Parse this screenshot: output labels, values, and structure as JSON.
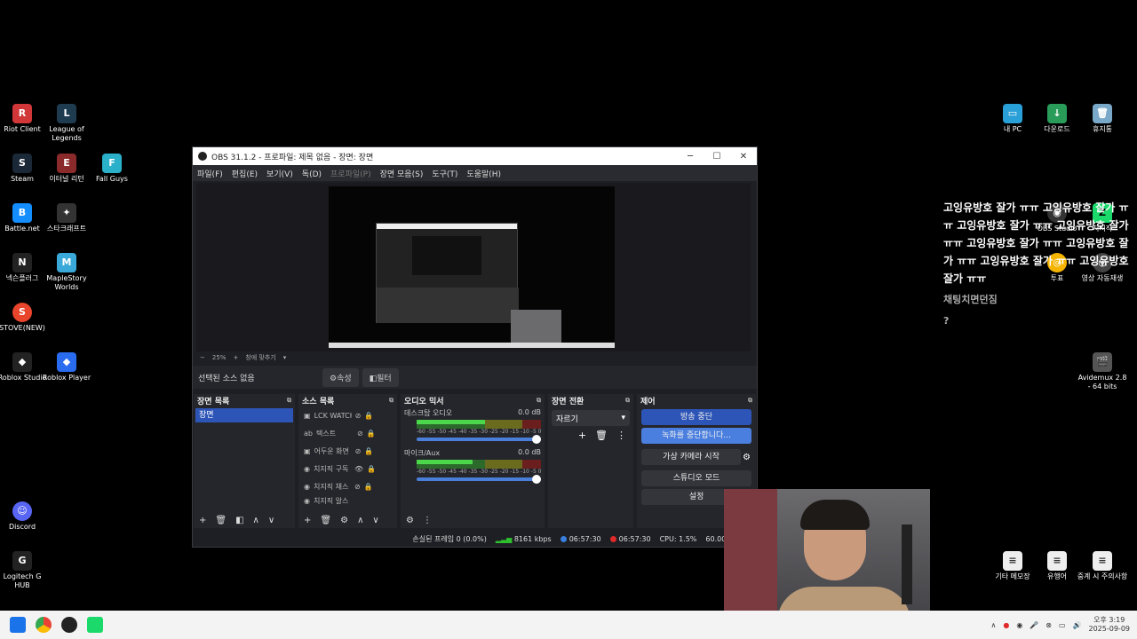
{
  "desktop_icons": [
    {
      "label": "Riot Client",
      "icon": "riot-icon",
      "color": "#d13639"
    },
    {
      "label": "League of Legends",
      "icon": "league-icon",
      "color": "#1f3b50"
    },
    {
      "label": "Steam",
      "icon": "steam-icon",
      "color": "#1b2838"
    },
    {
      "label": "이터널 리턴",
      "icon": "eternal-return-icon",
      "color": "#8b2a2a"
    },
    {
      "label": "Fall Guys",
      "icon": "fallguys-icon",
      "color": "#2ab0c8"
    },
    {
      "label": "Battle.net",
      "icon": "battlenet-icon",
      "color": "#148eff"
    },
    {
      "label": "스타크래프트",
      "icon": "starcraft-icon",
      "color": "#333"
    },
    {
      "label": "넥슨플러그",
      "icon": "nexon-icon",
      "color": "#222"
    },
    {
      "label": "MapleStory Worlds",
      "icon": "maplestory-icon",
      "color": "#3aa8d8"
    },
    {
      "label": "STOVE(NEW)",
      "icon": "stove-icon",
      "color": "#e8452c"
    },
    {
      "label": "Roblox Studio",
      "icon": "roblox-studio-icon",
      "color": "#222"
    },
    {
      "label": "Roblox Player",
      "icon": "roblox-player-icon",
      "color": "#2a6cf0"
    },
    {
      "label": "Discord",
      "icon": "discord-icon",
      "color": "#5865f2"
    },
    {
      "label": "Logitech G HUB",
      "icon": "logitech-icon",
      "color": "#222"
    },
    {
      "label": "내 PC",
      "icon": "pc-icon",
      "color": "#2aa0d8"
    },
    {
      "label": "다운로드",
      "icon": "download-icon",
      "color": "#2a9c5a"
    },
    {
      "label": "휴지통",
      "icon": "recycle-bin-icon",
      "color": "#7aa8c8"
    },
    {
      "label": "OBS Studio",
      "icon": "obs-icon",
      "color": "#333"
    },
    {
      "label": "치지직",
      "icon": "chzzk-icon",
      "color": "#1bd96a"
    },
    {
      "label": "투표",
      "icon": "vote-icon",
      "color": "#f5b400"
    },
    {
      "label": "영상 자동재생",
      "icon": "autoplay-icon",
      "color": "#444"
    },
    {
      "label": "Avidemux 2.8 - 64 bits",
      "icon": "avidemux-icon",
      "color": "#555"
    },
    {
      "label": "기타 메모장",
      "icon": "note-icon",
      "color": "#eee"
    },
    {
      "label": "유행어",
      "icon": "note-icon",
      "color": "#eee"
    },
    {
      "label": "중계 시 주의사항",
      "icon": "note-icon",
      "color": "#eee"
    }
  ],
  "obs": {
    "title": "OBS 31.1.2 - 프로파일: 제목 없음 - 장면: 장면",
    "menu": [
      "파일(F)",
      "편집(E)",
      "보기(V)",
      "독(D)",
      "프로파일(P)",
      "장면 모음(S)",
      "도구(T)",
      "도움말(H)"
    ],
    "zoom": "25%",
    "fit_label": "창에 맞추기",
    "no_source": "선택된 소스 없음",
    "properties_btn": "속성",
    "filters_btn": "필터",
    "docks": {
      "scenes": {
        "title": "장면 목록",
        "items": [
          "장면"
        ]
      },
      "sources": {
        "title": "소스 목록",
        "items": [
          "LCK WATCH",
          "텍스트",
          "어두운 화면",
          "치지직 구독",
          "치지직 채스",
          "치지직 알스"
        ]
      },
      "mixer": {
        "title": "오디오 믹서",
        "channels": [
          {
            "name": "데스크탑 오디오",
            "db": "0.0 dB",
            "level": 0.55
          },
          {
            "name": "마이크/Aux",
            "db": "0.0 dB",
            "level": 0.45
          }
        ],
        "ticks": "-60 -55 -50 -45 -40 -35 -30 -25 -20 -15 -10 -5 0"
      },
      "transitions": {
        "title": "장면 전환",
        "selected": "자르기"
      },
      "controls": {
        "title": "제어",
        "buttons": [
          "방송 중단",
          "녹화를 중단합니다...",
          "가상 카메라 시작",
          "스튜디오 모드",
          "설정"
        ]
      }
    },
    "status": {
      "dropped": "손실된 프레임 0 (0.0%)",
      "bitrate": "8161 kbps",
      "stream_time": "06:57:30",
      "rec_time": "06:57:30",
      "cpu": "CPU: 1.5%",
      "fps": "60.00 / 60.00"
    }
  },
  "chat": {
    "text": "고잉유방호 잘가 ㅠㅠ 고잉유방호 잘가 ㅠㅠ 고잉유방호 잘가 ㅠㅠ 고잉유방호 잘가 ㅠㅠ 고잉유방호 잘가 ㅠㅠ 고잉유방호 잘가 ㅠㅠ 고잉유방호 잘가 ㅠㅠ 고잉유방호 잘가 ㅠㅠ",
    "sub1": "채팅치면던짐",
    "sub2": "?"
  },
  "taskbar": {
    "time": "오후 3:19",
    "date": "2025-09-09"
  }
}
